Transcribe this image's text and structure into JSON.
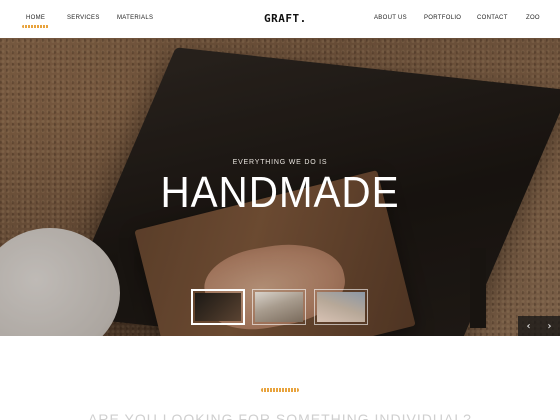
{
  "header": {
    "logo": "GRAFT.",
    "nav_left": [
      {
        "label": "HOME",
        "active": true
      },
      {
        "label": "SERVICES",
        "active": false
      },
      {
        "label": "MATERIALS",
        "active": false
      }
    ],
    "nav_right": [
      {
        "label": "ABOUT US"
      },
      {
        "label": "PORTFOLIO"
      },
      {
        "label": "CONTACT"
      },
      {
        "label": "ZOO"
      }
    ]
  },
  "hero": {
    "subtitle": "EVERYTHING WE DO IS",
    "title": "HANDMADE",
    "thumbnails": [
      {
        "label": "slide 1",
        "active": true
      },
      {
        "label": "slide 2",
        "active": false
      },
      {
        "label": "slide 3",
        "active": false
      }
    ],
    "arrows": {
      "prev": "‹",
      "next": "›"
    }
  },
  "section": {
    "heading": "ARE YOU LOOKING FOR SOMETHING INDIVIDUAL?"
  },
  "colors": {
    "accent": "#e8a33d",
    "text_dark": "#222222",
    "hero_text": "#ffffff"
  }
}
